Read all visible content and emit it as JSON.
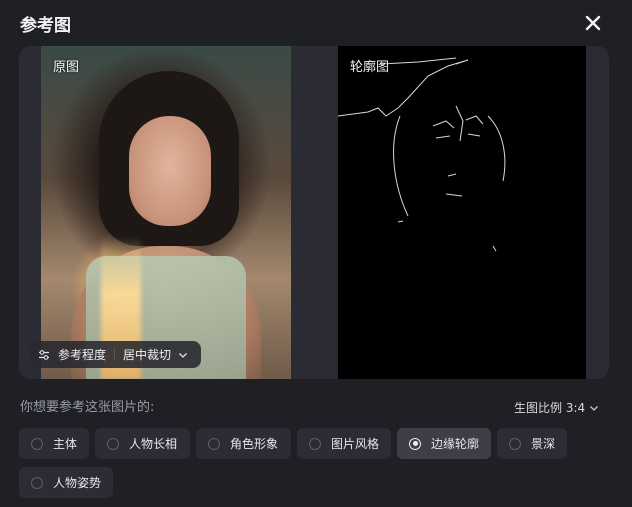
{
  "dialog": {
    "title": "参考图",
    "close_icon": "close-icon"
  },
  "preview": {
    "original_label": "原图",
    "contour_label": "轮廓图",
    "reference_chip": {
      "icon": "sliders-icon",
      "label": "参考程度",
      "crop_value": "居中裁切",
      "chevron": "chevron-down-icon"
    }
  },
  "question": "你想要参考这张图片的:",
  "ratio": {
    "label": "生图比例 3:4",
    "icon": "chevron-down-icon"
  },
  "options": [
    {
      "label": "主体",
      "selected": false
    },
    {
      "label": "人物长相",
      "selected": false
    },
    {
      "label": "角色形象",
      "selected": false
    },
    {
      "label": "图片风格",
      "selected": false
    },
    {
      "label": "边缘轮廓",
      "selected": true
    },
    {
      "label": "景深",
      "selected": false
    },
    {
      "label": "人物姿势",
      "selected": false
    }
  ]
}
